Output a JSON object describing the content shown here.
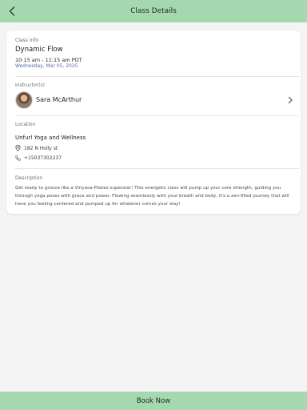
{
  "header": {
    "title": "Class Details"
  },
  "class_info": {
    "section_label": "Class Info",
    "name": "Dynamic Flow",
    "time": "10:15 am - 11:15 am PDT",
    "date": "Wednesday, Mar 05, 2025"
  },
  "instructors": {
    "section_label": "Instructor(s)",
    "items": [
      {
        "name": "Sara McArthur"
      }
    ]
  },
  "location": {
    "section_label": "Location",
    "venue": "Unfurl Yoga and Wellness",
    "address": "182 N Holly st",
    "phone": "+15037302237"
  },
  "description": {
    "section_label": "Description",
    "text": "Get ready to groove like a Vinyasa-Pilates superstar! This energetic class will pump up your core strength, guiding you through yoga poses with grace and power. Flowing seamlessly with your breath and body, it's a zen-filled journey that will have you feeling centered and pumped up for whatever comes your way!"
  },
  "footer": {
    "book_label": "Book Now"
  },
  "colors": {
    "accent": "#a6d8b0",
    "date_text": "#5a6bb0"
  }
}
